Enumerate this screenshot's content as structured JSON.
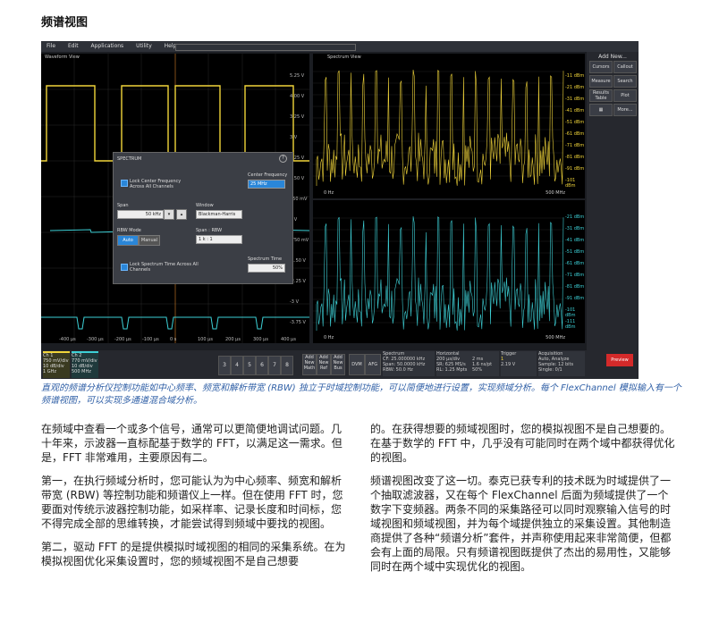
{
  "heading": "频谱视图",
  "screenshot": {
    "menu": [
      "File",
      "Edit",
      "Applications",
      "Utility",
      "Help"
    ],
    "waveform_view_label": "Waveform View",
    "spectrum_view_label": "Spectrum View",
    "side_panel": {
      "title": "Add New...",
      "buttons": [
        "Cursors",
        "Callout",
        "Measure",
        "Search",
        "Results Table",
        "Plot",
        "More..."
      ]
    },
    "wave_scale": [
      "5.25 V",
      "4.00 V",
      "3.25 V",
      "3 V",
      "2.25 V",
      "1.50 V",
      "750 mV",
      "0 V",
      "-750 mV",
      "-1.50 V",
      "-2.25 V",
      "-3 V",
      "-3.75 V"
    ],
    "spec_scale_top": [
      "-11 dBm",
      "-21 dBm",
      "-31 dBm",
      "-41 dBm",
      "-51 dBm",
      "-61 dBm",
      "-71 dBm",
      "-81 dBm",
      "-91 dBm",
      "-101 dBm"
    ],
    "spec_scale_bottom": [
      "-21 dBm",
      "-31 dBm",
      "-41 dBm",
      "-51 dBm",
      "-61 dBm",
      "-71 dBm",
      "-81 dBm",
      "-91 dBm",
      "-101 dBm",
      "-111 dBm"
    ],
    "spec_freq_end": "500 MHz",
    "spec_freq_start": "0 Hz",
    "time_ticks": [
      "-400 μs",
      "-300 μs",
      "-200 μs",
      "-100 μs",
      "0 s",
      "100 μs",
      "200 μs",
      "300 μs",
      "400 μs"
    ],
    "dialog": {
      "title": "SPECTRUM",
      "help": "?",
      "lock_center": "Lock Center Frequency Across All Channels",
      "center_frequency_label": "Center Frequency",
      "center_frequency_value": "25 MHz",
      "span_label": "Span",
      "span_value": "50 kHz",
      "window_label": "Window",
      "window_value": "Blackman-Harris",
      "rbw_mode_label": "RBW Mode",
      "rbw_auto": "Auto",
      "rbw_manual": "Manual",
      "span_rbw_label": "Span : RBW",
      "span_rbw_value": "1 k : 1",
      "lock_spectrum_time": "Lock Spectrum Time Across All Channels",
      "spectrum_time_label": "Spectrum Time",
      "spectrum_time_value": "50%"
    },
    "channel1": {
      "name": "Ch 1",
      "lines": [
        "750 mV/div",
        "10 dB/div",
        "1 GHz"
      ]
    },
    "channel2": {
      "name": "Ch 2",
      "lines": [
        "770 mV/div",
        "10 dB/div",
        "500 MHz"
      ]
    },
    "channel_numbers": [
      "3",
      "4",
      "5",
      "6",
      "7",
      "8"
    ],
    "add_buttons": [
      "Add New Math",
      "Add New Ref",
      "Add New Bus"
    ],
    "tool_buttons": [
      "DVM",
      "AFG"
    ],
    "spectrum_panel": {
      "title": "Spectrum",
      "lines": [
        "CF: 25.000000 kHz",
        "Span: 50.0000 kHz",
        "RBW: 50.0 Hz"
      ]
    },
    "horizontal_panel": {
      "title": "Horizontal",
      "lines": [
        "200 μs/div",
        "SR: 625 MS/s",
        "RL: 1.25 Mpts"
      ],
      "lines2": [
        "2 ms",
        "1.6 ns/pt",
        "50%"
      ]
    },
    "trigger_panel": {
      "title": "Trigger",
      "lines": [
        "1",
        "2.19 V"
      ]
    },
    "acquisition_panel": {
      "title": "Acquisition",
      "lines": [
        "Auto,    Analyze",
        "Sample: 12 bits",
        "Single: 0/1"
      ]
    },
    "preview_label": "Preview"
  },
  "caption": "直观的频谱分析仪控制功能如中心频率、频宽和解析带宽 (RBW) 独立于时域控制功能，可以简便地进行设置，实现频域分析。每个 FlexChannel 模拟输入有一个频谱视图，可以实现多通道混合域分析。",
  "paragraphs_left": [
    "在频域中查看一个或多个信号，通常可以更简便地调试问题。几十年来，示波器一直标配基于数学的 FFT，以满足这一需求。但是，FFT 非常难用，主要原因有二。",
    "第一，在执行频域分析时，您可能认为为中心频率、频宽和解析带宽 (RBW) 等控制功能和频谱仪上一样。但在使用 FFT 时，您要面对传统示波器控制功能，如采样率、记录长度和时间标，您不得完成全部的思维转换，才能尝试得到频域中要找的视图。",
    "第二，驱动 FFT 的是提供模拟时域视图的相同的采集系统。在为模拟视图优化采集设置时，您的频域视图不是自己想要"
  ],
  "paragraphs_right": [
    "的。在获得想要的频域视图时，您的模拟视图不是自己想要的。在基于数学的 FFT 中，几乎没有可能同时在两个域中都获得优化的视图。",
    "频谱视图改变了这一切。泰克已获专利的技术既为时域提供了一个抽取滤波器，又在每个 FlexChannel 后面为频域提供了一个数字下变频器。两条不同的采集路径可以同时观察输入信号的时域视图和频域视图，并为每个域提供独立的采集设置。其他制造商提供了各种“频谱分析”套件，并声称使用起来非常简便，但都会有上面的局限。只有频谱视图既提供了杰出的易用性，又能够同时在两个域中实现优化的视图。"
  ]
}
